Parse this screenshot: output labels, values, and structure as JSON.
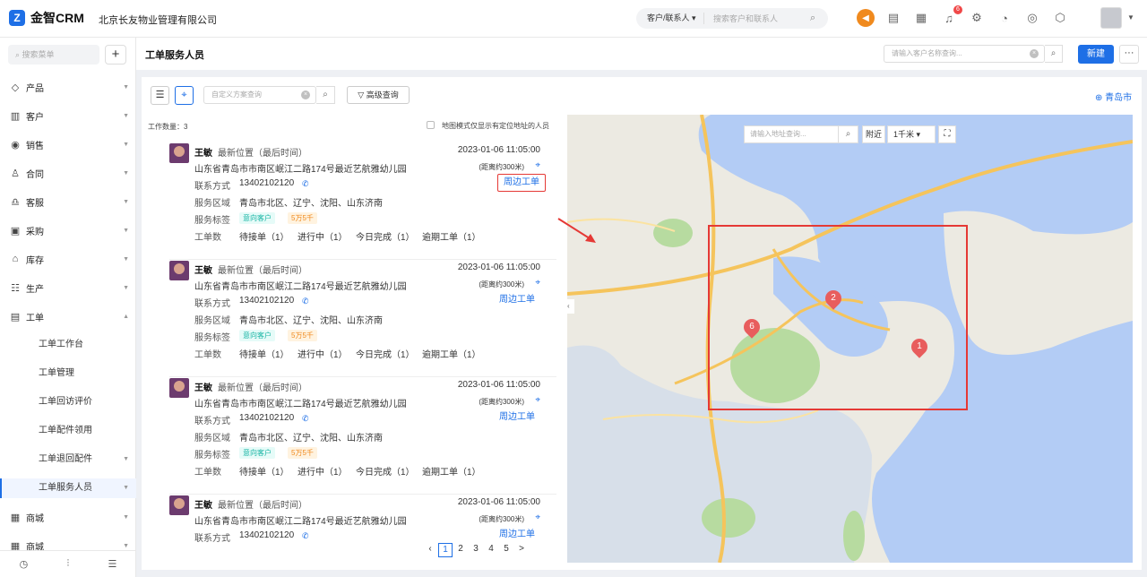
{
  "app": {
    "name": "金智CRM",
    "company": "北京长友物业管理有限公司",
    "accent": "#1e6fe6"
  },
  "topsearch": {
    "selector": "客户/联系人",
    "placeholder": "搜索客户和联系人"
  },
  "notifications": {
    "badge": "6"
  },
  "sidebar": {
    "search_placeholder": "搜索菜单",
    "add": "+",
    "items": [
      {
        "label": "产品",
        "icon": "cube-icon"
      },
      {
        "label": "客户",
        "icon": "building-icon"
      },
      {
        "label": "销售",
        "icon": "target-icon"
      },
      {
        "label": "合同",
        "icon": "contract-icon"
      },
      {
        "label": "客服",
        "icon": "headset-icon"
      },
      {
        "label": "采购",
        "icon": "bag-icon"
      },
      {
        "label": "库存",
        "icon": "warehouse-icon"
      },
      {
        "label": "生产",
        "icon": "factory-icon"
      },
      {
        "label": "工单",
        "icon": "document-icon"
      }
    ],
    "subitems": [
      {
        "label": "工单工作台"
      },
      {
        "label": "工单管理"
      },
      {
        "label": "工单回访评价"
      },
      {
        "label": "工单配件领用"
      },
      {
        "label": "工单退回配件"
      },
      {
        "label": "工单服务人员"
      }
    ],
    "bottom_items": [
      {
        "label": "商城"
      },
      {
        "label": "商城"
      }
    ]
  },
  "page": {
    "title": "工单服务人员",
    "search_placeholder": "请输入客户名称查询...",
    "new_label": "新建",
    "more_label": "···"
  },
  "toolbar": {
    "scheme_placeholder": "自定义方案查询",
    "advanced_label": "高级查询",
    "city": "青岛市"
  },
  "list": {
    "count_label": "工作数量：3",
    "map_only_label": "地图模式仅显示有定位地址的人员",
    "cards": [
      {
        "name": "王敏",
        "loc_label": "最新位置（最后时间）",
        "time": "2023-01-06 11:05:00",
        "address": "山东省青岛市市南区岷江二路174号最近艺航雅幼儿园",
        "distance": "(距离约300米)",
        "contact_label": "联系方式",
        "phone": "13402102120",
        "near_label": "周边工单",
        "area_label": "服务区域",
        "area": "青岛市北区、辽宁、沈阳、山东济南",
        "tags_label": "服务标签",
        "tag1": "意向客户",
        "tag2": "5万5千",
        "orders_label": "工单数",
        "s1": "待接单（1）",
        "s2": "进行中（1）",
        "s3": "今日完成（1）",
        "s4": "逾期工单（1）"
      },
      {
        "name": "王敏",
        "loc_label": "最新位置（最后时间）",
        "time": "2023-01-06 11:05:00",
        "address": "山东省青岛市市南区岷江二路174号最近艺航雅幼儿园",
        "distance": "(距离约300米)",
        "contact_label": "联系方式",
        "phone": "13402102120",
        "near_label": "周边工单",
        "area_label": "服务区域",
        "area": "青岛市北区、辽宁、沈阳、山东济南",
        "tags_label": "服务标签",
        "tag1": "意向客户",
        "tag2": "5万5千",
        "orders_label": "工单数",
        "s1": "待接单（1）",
        "s2": "进行中（1）",
        "s3": "今日完成（1）",
        "s4": "逾期工单（1）"
      },
      {
        "name": "王敏",
        "loc_label": "最新位置（最后时间）",
        "time": "2023-01-06 11:05:00",
        "address": "山东省青岛市市南区岷江二路174号最近艺航雅幼儿园",
        "distance": "(距离约300米)",
        "contact_label": "联系方式",
        "phone": "13402102120",
        "near_label": "周边工单",
        "area_label": "服务区域",
        "area": "青岛市北区、辽宁、沈阳、山东济南",
        "tags_label": "服务标签",
        "tag1": "意向客户",
        "tag2": "5万5千",
        "orders_label": "工单数",
        "s1": "待接单（1）",
        "s2": "进行中（1）",
        "s3": "今日完成（1）",
        "s4": "逾期工单（1）"
      },
      {
        "name": "王敏",
        "loc_label": "最新位置（最后时间）",
        "time": "2023-01-06 11:05:00",
        "address": "山东省青岛市市南区岷江二路174号最近艺航雅幼儿园",
        "distance": "(距离约300米)",
        "contact_label": "联系方式",
        "phone": "13402102120",
        "near_label": "周边工单"
      }
    ]
  },
  "pagination": {
    "pages": [
      "1",
      "2",
      "3",
      "4",
      "5"
    ],
    "current": "1",
    "next": ">"
  },
  "map": {
    "search_placeholder": "请输入地址查询...",
    "near_label": "附近",
    "range": "1千米",
    "markers": [
      "2",
      "6",
      "1"
    ]
  }
}
